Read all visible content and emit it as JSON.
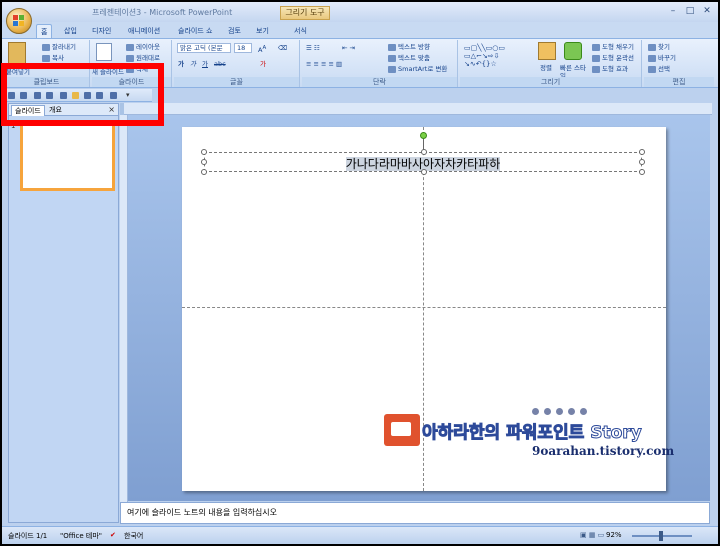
{
  "window": {
    "title": "프레젠테이션3 - Microsoft PowerPoint",
    "context_tab": "그리기 도구",
    "minimize": "–",
    "maximize": "□",
    "close": "✕"
  },
  "tabs": [
    {
      "label": "홈"
    },
    {
      "label": "삽입"
    },
    {
      "label": "디자인"
    },
    {
      "label": "애니메이션"
    },
    {
      "label": "슬라이드 쇼"
    },
    {
      "label": "검토"
    },
    {
      "label": "보기"
    },
    {
      "label": "서식"
    }
  ],
  "ribbon": {
    "clipboard": {
      "label": "클립보드",
      "cut": "잘라내기",
      "copy": "복사",
      "paste": "붙여넣기"
    },
    "slides": {
      "label": "슬라이드",
      "layout": "레이아웃",
      "reset": "원래대로",
      "delete": "삭제",
      "new": "새 슬라이드"
    },
    "font": {
      "label": "글꼴",
      "name": "맑은 고딕 (본문",
      "size": "18"
    },
    "paragraph": {
      "label": "단락",
      "text_direction": "텍스트 방향",
      "align_text": "텍스트 맞춤",
      "smartart": "SmartArt로 변환"
    },
    "drawing": {
      "label": "그리기",
      "arrange": "정렬",
      "quick_styles": "빠른 스타일",
      "shape_fill": "도형 채우기",
      "shape_outline": "도형 윤곽선",
      "shape_effects": "도형 효과"
    },
    "editing": {
      "label": "편집",
      "find": "찾기",
      "replace": "바꾸기",
      "select": "선택"
    }
  },
  "left_pane": {
    "tab_slides": "슬라이드",
    "tab_outline": "개요",
    "close": "×",
    "thumb_number": "1"
  },
  "slide": {
    "title_text": "가나다라마바사아자차카타파하"
  },
  "watermark": {
    "blog_name": "아하라한의 파워포인트 Story",
    "url": "9oarahan.tistory.com"
  },
  "notes": {
    "placeholder": "여기에 슬라이드 노트의 내용을 입력하십시오"
  },
  "status": {
    "slide_count": "슬라이드 1/1",
    "theme": "\"Office 테마\"",
    "language": "한국어",
    "zoom": "92%",
    "zoom_fraction": 0.92
  },
  "colors": {
    "highlight": "#ff0000",
    "ribbon_bg": "#c9dbf3",
    "selected_thumb_border": "#f6a43c"
  }
}
